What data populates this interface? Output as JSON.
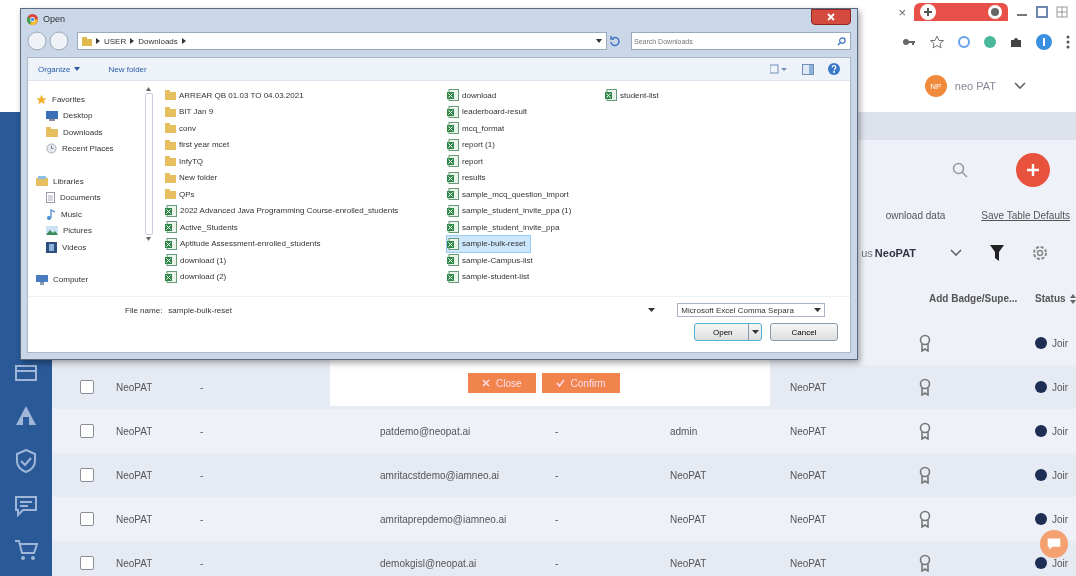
{
  "browser": {
    "tab_close": "×"
  },
  "app_header": {
    "avatar": "NP",
    "user": "neo PAT"
  },
  "tools": {
    "download_link": "ownload data",
    "save_link": "Save Table Defaults",
    "filter_label": "us",
    "campus_select": "NeoPAT"
  },
  "table": {
    "columns": [
      {
        "label": "Add Badge/Supe..."
      },
      {
        "label": "Status"
      }
    ],
    "rows": [
      {
        "status": "Joir"
      },
      {
        "checked": false,
        "name": "NeoPAT",
        "col_2": "-",
        "campus": "NeoPAT",
        "status": "Joir"
      },
      {
        "checked": false,
        "name": "NeoPAT",
        "col_2": "-",
        "email": "patdemo@neopat.ai",
        "col_4": "-",
        "role": "admin",
        "campus": "NeoPAT",
        "status": "Joir"
      },
      {
        "checked": false,
        "name": "NeoPAT",
        "col_2": "-",
        "email": "amritacstdemo@iamneo.ai",
        "col_4": "-",
        "role": "NeoPAT",
        "campus": "NeoPAT",
        "status": "Joir"
      },
      {
        "checked": false,
        "name": "NeoPAT",
        "col_2": "-",
        "email": "amritaprepdemo@iamneo.ai",
        "col_4": "-",
        "role": "NeoPAT",
        "campus": "NeoPAT",
        "status": "Joir"
      },
      {
        "checked": false,
        "name": "NeoPAT",
        "col_2": "-",
        "email": "demokgisl@neopat.ai",
        "col_4": "-",
        "role": "NeoPAT",
        "campus": "NeoPAT",
        "status": "Joir"
      }
    ]
  },
  "modal_buttons": [
    {
      "label": "Close",
      "kind": "close"
    },
    {
      "label": "Confirm",
      "kind": "confirm"
    }
  ],
  "dialog": {
    "title": "Open",
    "path": [
      "USER",
      "Downloads"
    ],
    "search_placeholder": "Search Downloads",
    "toolbar": [
      "Organize",
      "New folder"
    ],
    "nav": [
      {
        "label": "Favorites",
        "kind": "star",
        "children": [
          {
            "label": "Desktop",
            "kind": "monitor"
          },
          {
            "label": "Downloads",
            "kind": "folder"
          },
          {
            "label": "Recent Places",
            "kind": "clock"
          }
        ]
      },
      {
        "label": "Libraries",
        "kind": "library",
        "children": [
          {
            "label": "Documents",
            "kind": "document"
          },
          {
            "label": "Music",
            "kind": "music"
          },
          {
            "label": "Pictures",
            "kind": "picture"
          },
          {
            "label": "Videos",
            "kind": "video"
          }
        ]
      },
      {
        "label": "Computer",
        "kind": "computer"
      }
    ],
    "files": [
      {
        "name": "ARREAR QB 01.03 TO 04.03.2021",
        "kind": "folder",
        "selected": false
      },
      {
        "name": "BIT Jan 9",
        "kind": "folder",
        "selected": false
      },
      {
        "name": "conv",
        "kind": "folder",
        "selected": false
      },
      {
        "name": "first year mcet",
        "kind": "folder",
        "selected": false
      },
      {
        "name": "InfyTQ",
        "kind": "folder",
        "selected": false
      },
      {
        "name": "New folder",
        "kind": "folder",
        "selected": false
      },
      {
        "name": "QPs",
        "kind": "folder",
        "selected": false
      },
      {
        "name": "2022 Advanced Java Programming Course-enrolled_students",
        "kind": "sheet",
        "selected": false
      },
      {
        "name": "Active_Students",
        "kind": "sheet",
        "selected": false
      },
      {
        "name": "Aptitude Assessment-enrolled_students",
        "kind": "sheet",
        "selected": false
      },
      {
        "name": "download (1)",
        "kind": "sheet",
        "selected": false
      },
      {
        "name": "download (2)",
        "kind": "sheet",
        "selected": false
      },
      {
        "name": "download",
        "kind": "sheet",
        "selected": false
      },
      {
        "name": "leaderboard-result",
        "kind": "sheet",
        "selected": false
      },
      {
        "name": "mcq_format",
        "kind": "sheet",
        "selected": false
      },
      {
        "name": "report (1)",
        "kind": "sheet",
        "selected": false
      },
      {
        "name": "report",
        "kind": "sheet",
        "selected": false
      },
      {
        "name": "results",
        "kind": "sheet",
        "selected": false
      },
      {
        "name": "sample_mcq_question_import",
        "kind": "sheet",
        "selected": false
      },
      {
        "name": "sample_student_invite_ppa (1)",
        "kind": "sheet",
        "selected": false
      },
      {
        "name": "sample_student_invite_ppa",
        "kind": "sheet",
        "selected": false
      },
      {
        "name": "sample-bulk-reset",
        "kind": "sheet",
        "selected": true
      },
      {
        "name": "sample-Campus-list",
        "kind": "sheet",
        "selected": false
      },
      {
        "name": "sample-student-list",
        "kind": "sheet",
        "selected": false
      },
      {
        "name": "student-list",
        "kind": "sheet",
        "selected": false
      }
    ],
    "file_name_label": "File name:",
    "file_name": "sample-bulk-reset",
    "file_type": "Microsoft Excel Comma Separa",
    "buttons": [
      "Open",
      "Cancel"
    ]
  }
}
